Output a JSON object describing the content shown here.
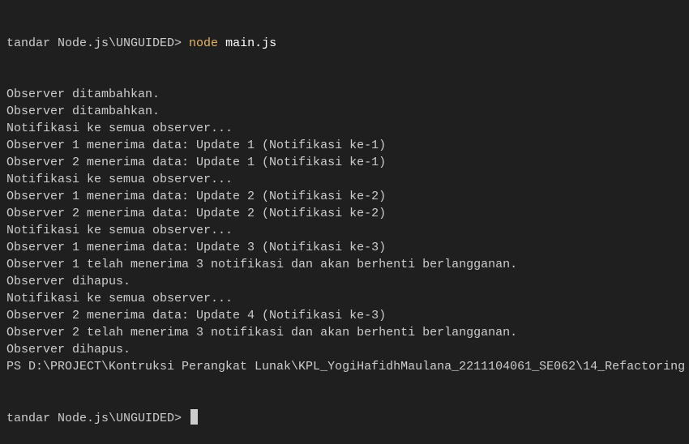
{
  "terminal": {
    "prompt_top": "tandar Node.js\\UNGUIDED> ",
    "command": "node",
    "command_arg": " main.js",
    "output": [
      "Observer ditambahkan.",
      "Observer ditambahkan.",
      "Notifikasi ke semua observer...",
      "Observer 1 menerima data: Update 1 (Notifikasi ke-1)",
      "Observer 2 menerima data: Update 1 (Notifikasi ke-1)",
      "Notifikasi ke semua observer...",
      "Observer 1 menerima data: Update 2 (Notifikasi ke-2)",
      "Observer 2 menerima data: Update 2 (Notifikasi ke-2)",
      "Notifikasi ke semua observer...",
      "Observer 1 menerima data: Update 3 (Notifikasi ke-3)",
      "Observer 1 telah menerima 3 notifikasi dan akan berhenti berlangganan.",
      "Observer dihapus.",
      "Notifikasi ke semua observer...",
      "Observer 2 menerima data: Update 4 (Notifikasi ke-3)",
      "Observer 2 telah menerima 3 notifikasi dan akan berhenti berlangganan.",
      "Observer dihapus.",
      "PS D:\\PROJECT\\Kontruksi Perangkat Lunak\\KPL_YogiHafidhMaulana_2211104061_SE062\\14_Refactoring"
    ],
    "prompt_bottom": "tandar Node.js\\UNGUIDED> "
  }
}
